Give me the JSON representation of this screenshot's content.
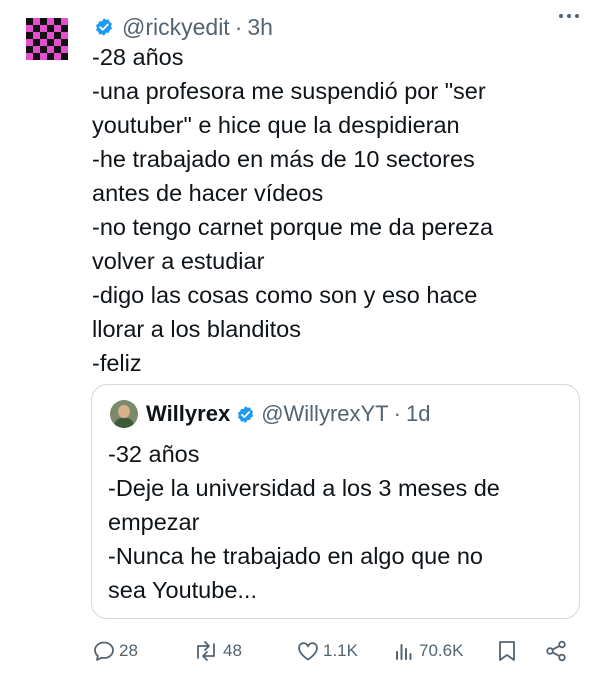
{
  "tweet": {
    "handle": "@rickyedit",
    "separator": "·",
    "time": "3h",
    "lines": [
      "-28 años",
      "-una profesora me suspendió por \"ser",
      "youtuber\" e hice que la despidieran",
      "-he trabajado en más de 10 sectores",
      "antes de hacer vídeos",
      "-no tengo carnet porque me da pereza",
      "volver a estudiar",
      "-digo las cosas como son y eso hace",
      "llorar a los blanditos",
      "-feliz"
    ]
  },
  "quote": {
    "name": "Willyrex",
    "handle": "@WillyrexYT",
    "separator": "·",
    "time": "1d",
    "lines": [
      "-32 años",
      "-Deje la universidad a los 3 meses de",
      "empezar",
      "-Nunca he trabajado en algo que no",
      "sea Youtube..."
    ]
  },
  "actions": {
    "replies": "28",
    "reposts": "48",
    "likes": "1.1K",
    "views": "70.6K"
  },
  "colors": {
    "accent": "#1d9bf0",
    "muted": "#536471",
    "avatar_pink": "#e34fcf",
    "avatar_black": "#111111"
  },
  "icons": [
    "verified-badge-icon",
    "more-options-icon",
    "reply-icon",
    "repost-icon",
    "like-icon",
    "views-icon",
    "bookmark-icon",
    "share-icon"
  ]
}
